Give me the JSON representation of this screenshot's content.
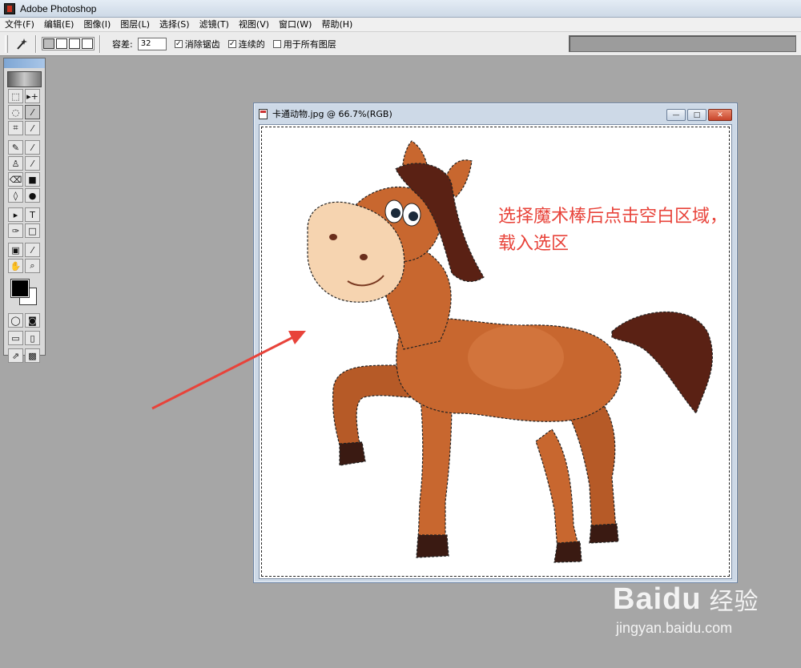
{
  "app": {
    "title": "Adobe Photoshop"
  },
  "menu": [
    "文件(F)",
    "编辑(E)",
    "图像(I)",
    "图层(L)",
    "选择(S)",
    "滤镜(T)",
    "视图(V)",
    "窗口(W)",
    "帮助(H)"
  ],
  "options": {
    "tolerance_label": "容差:",
    "tolerance_value": "32",
    "anti_alias_label": "消除锯齿",
    "anti_alias_mark": "✓",
    "contiguous_label": "连续的",
    "contiguous_mark": "✓",
    "all_layers_label": "用于所有图层"
  },
  "tools": [
    [
      "⬚",
      "▸+"
    ],
    [
      "◌",
      "⁄"
    ],
    [
      "⌗",
      "⁄"
    ],
    [
      "✎",
      "⁄"
    ],
    [
      "♙",
      "⁄"
    ],
    [
      "⌫",
      "■"
    ],
    [
      "◊",
      "●"
    ],
    [
      "▸",
      "T"
    ],
    [
      "✑",
      "□"
    ],
    [
      "▣",
      "⁄"
    ],
    [
      "✋",
      "⌕"
    ]
  ],
  "document": {
    "title": "卡通动物.jpg @ 66.7%(RGB)",
    "min_label": "—",
    "max_label": "□",
    "close_label": "✕"
  },
  "annotation": {
    "line1": "选择魔术棒后点击空白区域，",
    "line2": "载入选区"
  },
  "watermark": {
    "brand": "Baidu",
    "brand_cn": "经验",
    "url": "jingyan.baidu.com"
  },
  "colors": {
    "annotation": "#e8433a",
    "workspace": "#a6a6a6",
    "horse_body": "#c8672f",
    "mane": "#5a2114"
  }
}
